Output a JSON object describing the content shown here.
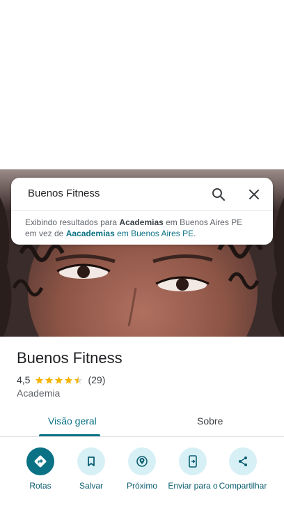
{
  "search": {
    "query": "Buenos Fitness",
    "suggestion_prefix": "Exibindo resultados para ",
    "suggestion_term": "Academias",
    "suggestion_location": " em Buenos Aires PE",
    "suggestion_alt_prefix": "em vez de ",
    "suggestion_alt_term": "Aacademias",
    "suggestion_alt_location": " em Buenos Aires PE",
    "suggestion_end": "."
  },
  "place": {
    "name": "Buenos Fitness",
    "rating": "4,5",
    "rating_value": 4.5,
    "review_count": "(29)",
    "category": "Academia"
  },
  "tabs": [
    {
      "label": "Visão geral",
      "active": true
    },
    {
      "label": "Sobre",
      "active": false
    }
  ],
  "actions": [
    {
      "label": "Rotas",
      "icon": "directions-icon"
    },
    {
      "label": "Salvar",
      "icon": "bookmark-icon"
    },
    {
      "label": "Próximo",
      "icon": "nearby-icon"
    },
    {
      "label": "Enviar para o",
      "icon": "send-to-phone-icon"
    },
    {
      "label": "Compartilhar",
      "icon": "share-icon"
    }
  ],
  "colors": {
    "accent": "#0b7285",
    "star": "#f4b400",
    "action_bg": "#d7f0f6"
  }
}
